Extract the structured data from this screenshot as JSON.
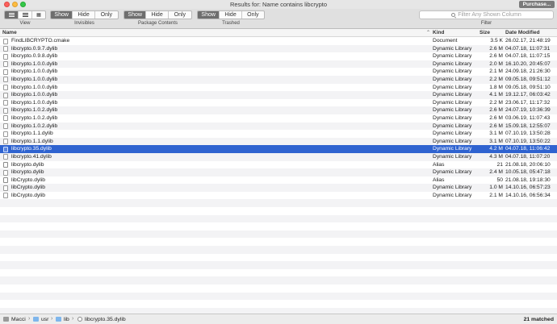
{
  "window": {
    "title": "Results for: Name contains libcrypto",
    "purchase_label": "Purchase..."
  },
  "toolbar": {
    "view_label": "View",
    "invisibles": {
      "show": "Show",
      "hide": "Hide",
      "only": "Only",
      "label": "Invisibles"
    },
    "package_contents": {
      "show": "Show",
      "hide": "Hide",
      "only": "Only",
      "label": "Package Contents"
    },
    "trashed": {
      "show": "Show",
      "hide": "Hide",
      "only": "Only",
      "label": "Trashed"
    },
    "search_placeholder": "Filter Any Shown Column",
    "filter_label": "Filter"
  },
  "columns": {
    "name": "Name",
    "kind": "Kind",
    "size": "Size",
    "date": "Date Modified"
  },
  "rows": [
    {
      "name": "FindLIBCRYPTO.cmake",
      "kind": "Document",
      "size": "3.5 K",
      "date": "26.02.17, 21:48:19"
    },
    {
      "name": "libcrypto.0.9.7.dylib",
      "kind": "Dynamic Library",
      "size": "2.6 M",
      "date": "04.07.18, 11:07:31"
    },
    {
      "name": "libcrypto.0.9.8.dylib",
      "kind": "Dynamic Library",
      "size": "2.6 M",
      "date": "04.07.18, 11:07:15"
    },
    {
      "name": "libcrypto.1.0.0.dylib",
      "kind": "Dynamic Library",
      "size": "2.0 M",
      "date": "16.10.20, 20:45:07"
    },
    {
      "name": "libcrypto.1.0.0.dylib",
      "kind": "Dynamic Library",
      "size": "2.1 M",
      "date": "24.09.18, 21:26:30"
    },
    {
      "name": "libcrypto.1.0.0.dylib",
      "kind": "Dynamic Library",
      "size": "2.2 M",
      "date": "09.05.18, 09:51:12"
    },
    {
      "name": "libcrypto.1.0.0.dylib",
      "kind": "Dynamic Library",
      "size": "1.8 M",
      "date": "09.05.18, 09:51:10"
    },
    {
      "name": "libcrypto.1.0.0.dylib",
      "kind": "Dynamic Library",
      "size": "4.1 M",
      "date": "19.12.17, 06:03:42"
    },
    {
      "name": "libcrypto.1.0.0.dylib",
      "kind": "Dynamic Library",
      "size": "2.2 M",
      "date": "23.06.17, 11:17:32"
    },
    {
      "name": "libcrypto.1.0.2.dylib",
      "kind": "Dynamic Library",
      "size": "2.6 M",
      "date": "24.07.19, 10:36:39"
    },
    {
      "name": "libcrypto.1.0.2.dylib",
      "kind": "Dynamic Library",
      "size": "2.6 M",
      "date": "03.06.19, 11:07:43"
    },
    {
      "name": "libcrypto.1.0.2.dylib",
      "kind": "Dynamic Library",
      "size": "2.6 M",
      "date": "15.09.18, 12:55:07"
    },
    {
      "name": "libcrypto.1.1.dylib",
      "kind": "Dynamic Library",
      "size": "3.1 M",
      "date": "07.10.19, 13:50:28"
    },
    {
      "name": "libcrypto.1.1.dylib",
      "kind": "Dynamic Library",
      "size": "3.1 M",
      "date": "07.10.19, 13:50:22"
    },
    {
      "name": "libcrypto.35.dylib",
      "kind": "Dynamic Library",
      "size": "4.2 M",
      "date": "04.07.18, 11:06:42",
      "selected": true
    },
    {
      "name": "libcrypto.41.dylib",
      "kind": "Dynamic Library",
      "size": "4.3 M",
      "date": "04.07.18, 11:07:20"
    },
    {
      "name": "libcrypto.dylib",
      "kind": "Alias",
      "size": "21",
      "date": "21.08.18, 20:06:10"
    },
    {
      "name": "libcrypto.dylib",
      "kind": "Dynamic Library",
      "size": "2.4 M",
      "date": "10.05.18, 05:47:18"
    },
    {
      "name": "libCrypto.dylib",
      "kind": "Alias",
      "size": "50",
      "date": "21.08.18, 19:18:30"
    },
    {
      "name": "libCrypto.dylib",
      "kind": "Dynamic Library",
      "size": "1.0 M",
      "date": "14.10.16, 06:57:23"
    },
    {
      "name": "libCrypto.dylib",
      "kind": "Dynamic Library",
      "size": "2.1 M",
      "date": "14.10.16, 06:56:34"
    }
  ],
  "pathbar": {
    "items": [
      "Macci",
      "usr",
      "lib",
      "libcrypto.35.dylib"
    ],
    "matched": "21 matched"
  },
  "colors": {
    "selection": "#2f63d0",
    "active_segment": "#6e6e6e",
    "folder": "#7fb6ec"
  }
}
